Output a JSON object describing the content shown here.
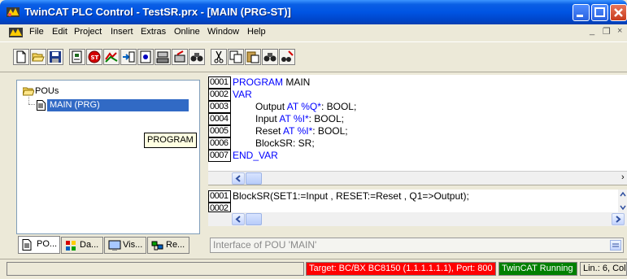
{
  "window": {
    "title": "TwinCAT PLC Control - TestSR.prx - [MAIN (PRG-ST)]",
    "icon": "twincat-app-icon"
  },
  "menu": {
    "items": [
      "File",
      "Edit",
      "Project",
      "Insert",
      "Extras",
      "Online",
      "Window",
      "Help"
    ],
    "mdi_minimize": "_",
    "mdi_restore": "❐",
    "mdi_close": "×"
  },
  "toolbar": {
    "buttons": [
      "new-icon",
      "open-icon",
      "save-icon",
      "login-icon",
      "stop-icon",
      "run-icon",
      "step-icon",
      "reset-icon",
      "download-icon",
      "find-icon",
      "cut-icon",
      "copy-icon",
      "paste-icon",
      "find-next-icon",
      "replace-icon"
    ]
  },
  "tree": {
    "root_label": "POUs",
    "selected_item": "MAIN (PRG)",
    "tooltip": "PROGRAM"
  },
  "left_tabs": [
    {
      "label": "PO...",
      "icon": "pou-tab-icon"
    },
    {
      "label": "Da...",
      "icon": "datatypes-tab-icon"
    },
    {
      "label": "Vis...",
      "icon": "visualization-tab-icon"
    },
    {
      "label": "Re...",
      "icon": "resources-tab-icon"
    }
  ],
  "declaration": {
    "line_numbers": [
      "0001",
      "0002",
      "0003",
      "0004",
      "0005",
      "0006",
      "0007"
    ],
    "l1_kw": "PROGRAM",
    "l1_rest": " MAIN",
    "l2_kw": "VAR",
    "l3_var": "Output",
    "l3_kw": " AT %Q*",
    "l3_type": ": BOOL;",
    "l4_var": "Input",
    "l4_kw": " AT %I*",
    "l4_type": ": BOOL;",
    "l5_var": "Reset",
    "l5_kw": " AT %I*",
    "l5_type": ": BOOL;",
    "l6_text": "BlockSR: SR;",
    "l7_kw": "END_VAR"
  },
  "body": {
    "line_numbers": [
      "0001",
      "0002"
    ],
    "line1": "BlockSR(SET1:=Input , RESET:=Reset , Q1=>Output);"
  },
  "interface_field": "Interface of POU 'MAIN'",
  "status": {
    "target": "Target: BC/BX BC8150 (1.1.1.1.1.1), Port: 800",
    "running": "TwinCAT Running",
    "position": "Lin.: 6, Col.",
    "colors": {
      "target_bg": "#ff0000",
      "running_bg": "#008000"
    }
  }
}
